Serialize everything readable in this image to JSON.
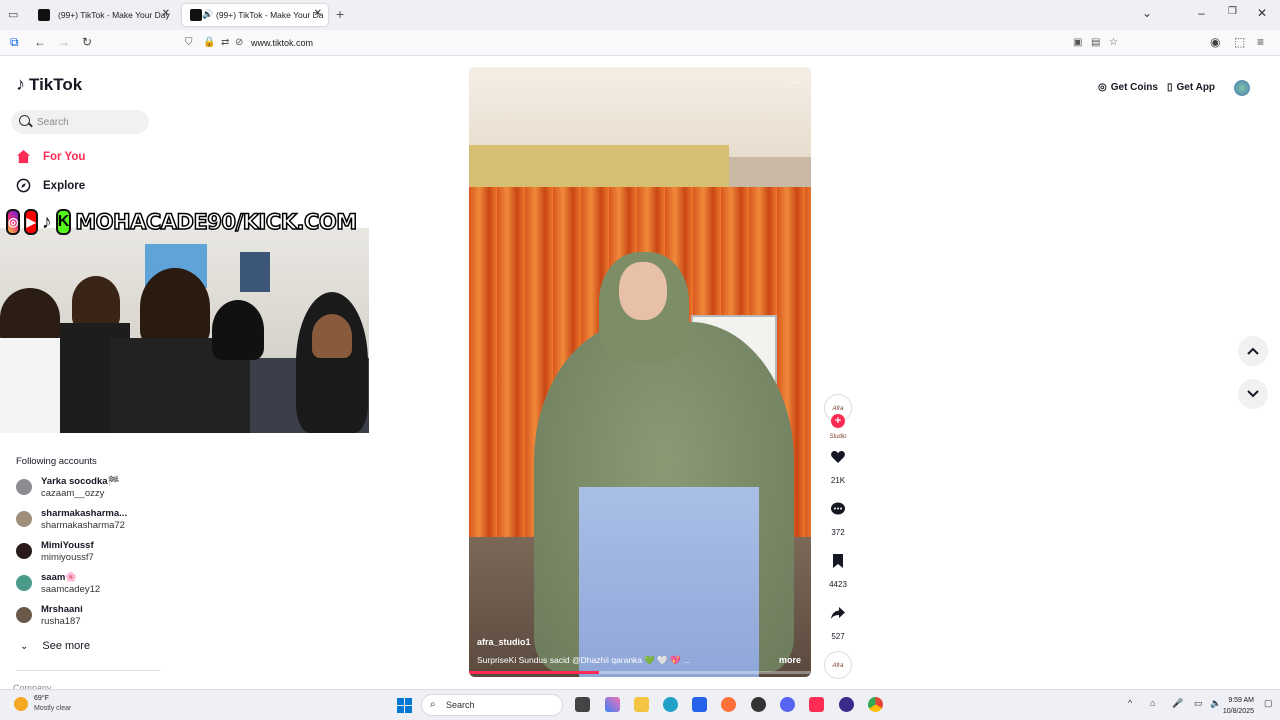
{
  "browser": {
    "tabs": [
      {
        "title": "(99+) TikTok - Make Your Day"
      },
      {
        "title": "(99+) TikTok - Make Your Da"
      }
    ],
    "url": "www.tiktok.com"
  },
  "tiktok": {
    "logo": "TikTok",
    "search_placeholder": "Search",
    "nav": {
      "for_you": "For You",
      "explore": "Explore"
    },
    "following_title": "Following accounts",
    "accounts": [
      {
        "display": "Yarka socodka🏁",
        "user": "cazaam__ozzy",
        "color": "#8b8d92"
      },
      {
        "display": "sharmakasharma...",
        "user": "sharmakasharma72",
        "color": "#a08f7c"
      },
      {
        "display": "MimiYoussf",
        "user": "mimiyoussf7",
        "color": "#2b1a1a"
      },
      {
        "display": "saam🌸",
        "user": "saamcadey12",
        "color": "#4a9a8a"
      },
      {
        "display": "Mrshaani",
        "user": "rusha187",
        "color": "#6b5a4a"
      }
    ],
    "see_more": "See more",
    "company": "Company",
    "get_coins": "Get Coins",
    "get_app": "Get App"
  },
  "overlay": {
    "channel": "MOHACADE90/KICK.COM"
  },
  "video": {
    "username": "afra_studio1",
    "caption": "SurpriseKi Sundus sacid @Dhazhii qaranka 💚 🤍 💖 ...",
    "more": "more",
    "progress": 0.38,
    "author_logo": "Afra Studio"
  },
  "actions": {
    "likes": "21K",
    "comments": "372",
    "saves": "4423",
    "shares": "527"
  },
  "taskbar": {
    "temp": "69°F",
    "weather": "Mostly clear",
    "search": "Search",
    "time": "9:59 AM",
    "date": "10/8/2025"
  },
  "colors": {
    "accent": "#fe2c55"
  }
}
